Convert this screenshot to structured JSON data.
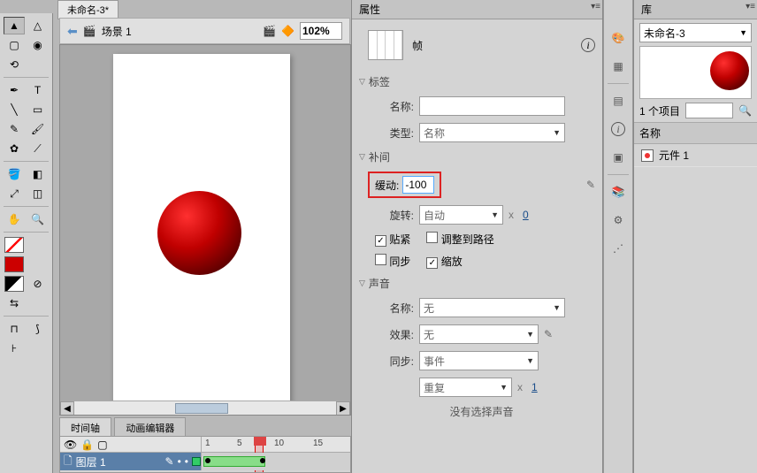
{
  "doc_tab": "未命名-3*",
  "scene": {
    "label": "场景 1",
    "zoom": "102%"
  },
  "timeline": {
    "tab_timeline": "时间轴",
    "tab_motion": "动画编辑器",
    "layer_name": "图层 1",
    "marks": {
      "n1": "1",
      "n5": "5",
      "n10": "10",
      "n15": "15"
    }
  },
  "props": {
    "panel_title": "属性",
    "frame_label": "帧",
    "sec_label": "标签",
    "name_label": "名称:",
    "type_label": "类型:",
    "type_value": "名称",
    "sec_tween": "补间",
    "ease_label": "缓动:",
    "ease_value": "-100",
    "rotate_label": "旋转:",
    "rotate_value": "自动",
    "rotate_times": "0",
    "snap_label": "贴紧",
    "adjust_label": "调整到路径",
    "sync_label": "同步",
    "scale_label": "缩放",
    "sec_sound": "声音",
    "sound_name_label": "名称:",
    "sound_name_value": "无",
    "effect_label": "效果:",
    "effect_value": "无",
    "soundsync_label": "同步:",
    "soundsync_value": "事件",
    "repeat_value": "重复",
    "repeat_times": "1",
    "no_sound": "没有选择声音",
    "x_label": "x"
  },
  "library": {
    "panel_title": "库",
    "doc_name": "未命名-3",
    "item_count": "1 个项目",
    "col_name": "名称",
    "item1": "元件 1"
  }
}
